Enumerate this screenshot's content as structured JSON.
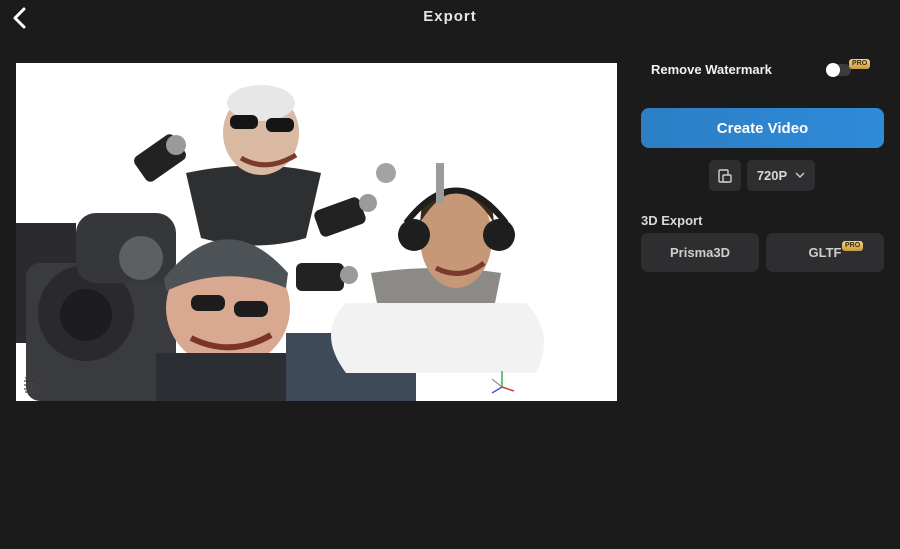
{
  "header": {
    "title": "Export",
    "back_icon": "chevron-left-icon"
  },
  "preview": {
    "description_icons": [
      "camera-snapshot-icon",
      "axis-gizmo-icon"
    ]
  },
  "watermark": {
    "label": "Remove Watermark",
    "pro_badge": "PRO",
    "enabled": false
  },
  "create": {
    "label": "Create Video"
  },
  "options": {
    "resolution": "720P",
    "aspect_icon": "aspect-ratio-icon"
  },
  "export3d": {
    "section_label": "3D Export",
    "prisma_label": "Prisma3D",
    "gltf_label": "GLTF",
    "gltf_badge": "PRO"
  },
  "colors": {
    "background": "#1b1b1c",
    "accent": "#2f8ad9",
    "button": "#2e2e30"
  }
}
